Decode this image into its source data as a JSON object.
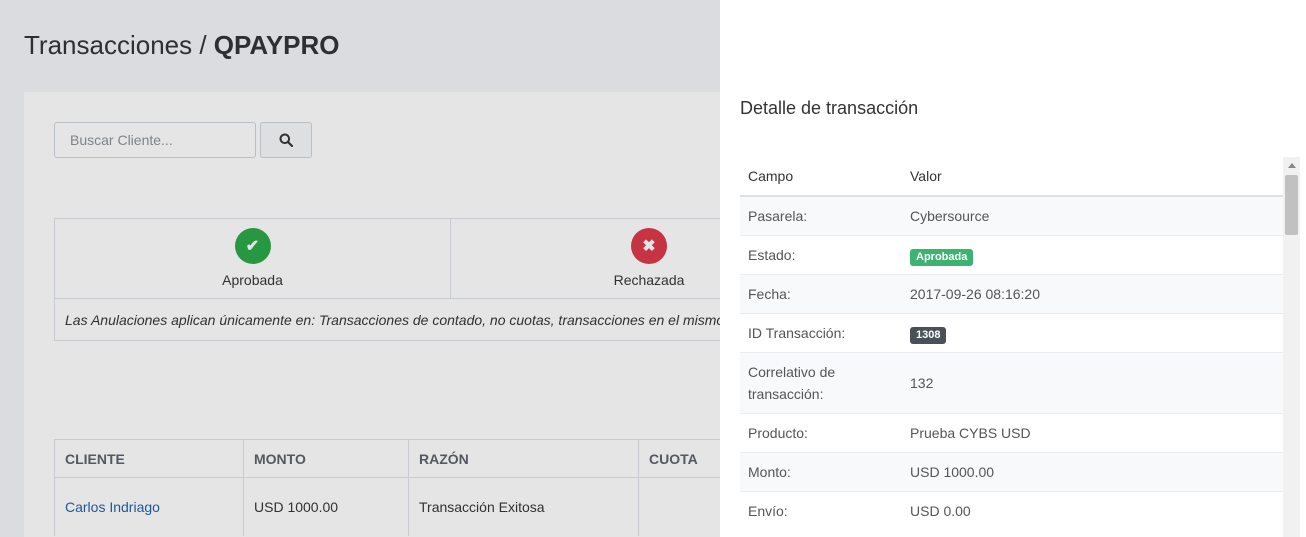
{
  "page": {
    "title_prefix": "Transacciones / ",
    "title_bold": "QPAYPRO",
    "search": {
      "placeholder": "Buscar Cliente...",
      "button_icon": "search-icon"
    },
    "statuses": [
      {
        "label": "Aprobada",
        "icon": "check-icon",
        "color": "#28a745"
      },
      {
        "label": "Rechazada",
        "icon": "times-icon",
        "color": "#dc3545"
      }
    ],
    "note": "Las Anulaciones aplican únicamente en: Transacciones de contado, no cuotas, transacciones en el mismo",
    "table": {
      "headers": [
        "CLIENTE",
        "MONTO",
        "RAZÓN",
        "CUOTA"
      ],
      "rows": [
        {
          "cliente": "Carlos Indriago",
          "monto": "USD 1000.00",
          "razon": "Transacción Exitosa",
          "cuota": ""
        }
      ]
    }
  },
  "panel": {
    "title": "Detalle de transacción",
    "headers": {
      "field": "Campo",
      "value": "Valor"
    },
    "rows": [
      {
        "field": "Pasarela:",
        "value": "Cybersource"
      },
      {
        "field": "Estado:",
        "value": "Aprobada"
      },
      {
        "field": "Fecha:",
        "value": "2017-09-26 08:16:20"
      },
      {
        "field": "ID Transacción:",
        "value": "1308"
      },
      {
        "field": "Correlativo de transacción:",
        "value": "132"
      },
      {
        "field": "Producto:",
        "value": "Prueba CYBS USD"
      },
      {
        "field": "Monto:",
        "value": "USD 1000.00"
      },
      {
        "field": "Envío:",
        "value": "USD 0.00"
      }
    ],
    "badge_colors": {
      "estado": "#3cb371",
      "id": "#495057"
    }
  }
}
